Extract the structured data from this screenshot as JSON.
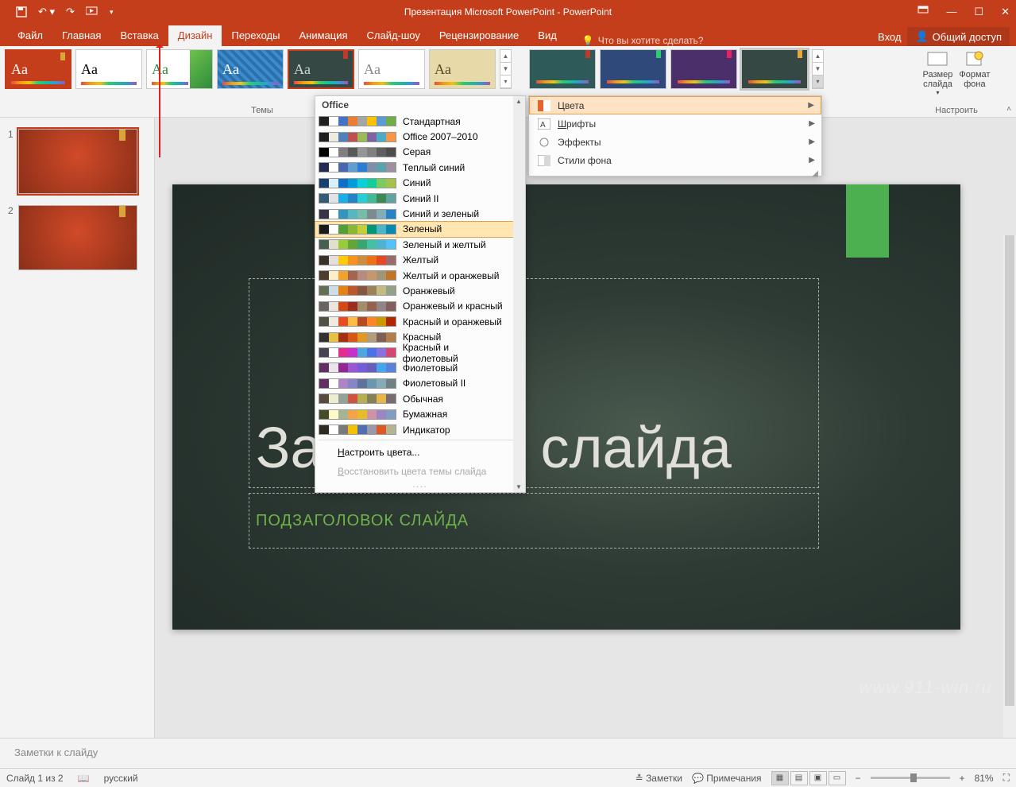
{
  "title": "Презентация Microsoft PowerPoint - PowerPoint",
  "tabs": [
    "Файл",
    "Главная",
    "Вставка",
    "Дизайн",
    "Переходы",
    "Анимация",
    "Слайд-шоу",
    "Рецензирование",
    "Вид"
  ],
  "active_tab": "Дизайн",
  "tell_me": "Что вы хотите сделать?",
  "sign_in": "Вход",
  "share": "Общий доступ",
  "themes_label": "Темы",
  "custom": {
    "size": "Размер\nслайда",
    "format": "Формат\nфона",
    "group": "Настроить"
  },
  "slide_thumbs": [
    {
      "num": "1"
    },
    {
      "num": "2"
    }
  ],
  "slide": {
    "title": "Заголовок слайда",
    "subtitle": "ПОДЗАГОЛОВОК СЛАЙДА"
  },
  "notes_placeholder": "Заметки к слайду",
  "status": {
    "slide": "Слайд 1 из 2",
    "lang": "русский",
    "notes": "Заметки",
    "comments": "Примечания",
    "zoom": "81%"
  },
  "variants_menu": [
    {
      "label": "Цвета",
      "icon": "colors",
      "hover": true
    },
    {
      "label": "Шрифты",
      "icon": "fonts",
      "underline": "Ш"
    },
    {
      "label": "Эффекты",
      "icon": "effects"
    },
    {
      "label": "Стили фона",
      "icon": "bg"
    }
  ],
  "colors_header": "Office",
  "colors_list": [
    {
      "name": "Стандартная",
      "sw": [
        "#1f1f1f",
        "#ffffff",
        "#4472c4",
        "#ed7d31",
        "#a5a5a5",
        "#ffc000",
        "#5b9bd5",
        "#70ad47"
      ]
    },
    {
      "name": "Office 2007–2010",
      "sw": [
        "#1f1f1f",
        "#eeece1",
        "#4f81bd",
        "#c0504d",
        "#9bbb59",
        "#8064a2",
        "#4bacc6",
        "#f79646"
      ]
    },
    {
      "name": "Серая",
      "sw": [
        "#000000",
        "#ffffff",
        "#7f7f7f",
        "#595959",
        "#969696",
        "#808080",
        "#5f5f5f",
        "#4d4d4d"
      ]
    },
    {
      "name": "Теплый синий",
      "sw": [
        "#242852",
        "#ffffff",
        "#4a66ac",
        "#629dd1",
        "#297fd5",
        "#7f8fa9",
        "#5aa2ae",
        "#9d90a0"
      ]
    },
    {
      "name": "Синий",
      "sw": [
        "#17406d",
        "#dbefff",
        "#0f6fc6",
        "#009dd9",
        "#0bd0d9",
        "#10cf9b",
        "#7cca62",
        "#a5c249"
      ]
    },
    {
      "name": "Синий II",
      "sw": [
        "#335b74",
        "#dfe3e5",
        "#1cade4",
        "#2683c6",
        "#27ced7",
        "#42ba97",
        "#3e8853",
        "#62a39f"
      ]
    },
    {
      "name": "Синий и зеленый",
      "sw": [
        "#373545",
        "#ffffff",
        "#3494ba",
        "#58b6c0",
        "#75bda7",
        "#7a8c8e",
        "#84acb6",
        "#2683c6"
      ]
    },
    {
      "name": "Зеленый",
      "sw": [
        "#1a1a1a",
        "#ffffff",
        "#549e39",
        "#8ab833",
        "#c0cf3a",
        "#029676",
        "#4ab5c4",
        "#0989b1"
      ],
      "hover": true
    },
    {
      "name": "Зеленый и желтый",
      "sw": [
        "#455f51",
        "#e2dfcc",
        "#99cb38",
        "#63a537",
        "#37a76f",
        "#44c1a3",
        "#4eb3cf",
        "#51c3f9"
      ]
    },
    {
      "name": "Желтый",
      "sw": [
        "#39302a",
        "#e5dedb",
        "#ffca08",
        "#f8931d",
        "#ce8d3e",
        "#ec7016",
        "#e64823",
        "#9c6a6a"
      ]
    },
    {
      "name": "Желтый и оранжевый",
      "sw": [
        "#4e3b30",
        "#fbeec9",
        "#f0a22e",
        "#a5644e",
        "#b58b80",
        "#c3986d",
        "#a19574",
        "#c17529"
      ]
    },
    {
      "name": "Оранжевый",
      "sw": [
        "#637052",
        "#ccddea",
        "#e48312",
        "#bd582c",
        "#865640",
        "#9b8357",
        "#c2bc80",
        "#94a088"
      ]
    },
    {
      "name": "Оранжевый и красный",
      "sw": [
        "#696464",
        "#e9e5dc",
        "#d34817",
        "#9b2d1f",
        "#a28e6a",
        "#956251",
        "#918485",
        "#855d5d"
      ]
    },
    {
      "name": "Красный и оранжевый",
      "sw": [
        "#505046",
        "#eeece1",
        "#e84c22",
        "#ffbd47",
        "#b64926",
        "#ff8427",
        "#cc9900",
        "#b22600"
      ]
    },
    {
      "name": "Красный",
      "sw": [
        "#323232",
        "#e5c243",
        "#a5300f",
        "#d55816",
        "#e19825",
        "#b19c7d",
        "#7f5f52",
        "#b27d49"
      ]
    },
    {
      "name": "Красный и фиолетовый",
      "sw": [
        "#454551",
        "#ffffff",
        "#e32d91",
        "#c830cc",
        "#4ea6dc",
        "#4775e7",
        "#8971e1",
        "#d54773"
      ]
    },
    {
      "name": "Фиолетовый",
      "sw": [
        "#632e62",
        "#eae5eb",
        "#92278f",
        "#9b57d3",
        "#755dd9",
        "#665eb8",
        "#45a5ed",
        "#5982db"
      ]
    },
    {
      "name": "Фиолетовый II",
      "sw": [
        "#632e62",
        "#ffffff",
        "#ad84c6",
        "#8784c7",
        "#5d739a",
        "#6997af",
        "#84acb6",
        "#6f8183"
      ]
    },
    {
      "name": "Обычная",
      "sw": [
        "#564b3c",
        "#ecedd1",
        "#93a299",
        "#cf543f",
        "#b5ae53",
        "#848058",
        "#e8b54d",
        "#786c71"
      ]
    },
    {
      "name": "Бумажная",
      "sw": [
        "#444d26",
        "#fefac9",
        "#a5b592",
        "#f3a447",
        "#e7bc29",
        "#d092a7",
        "#9c85c0",
        "#809ec2"
      ]
    },
    {
      "name": "Индикатор",
      "sw": [
        "#2f2b20",
        "#ffffff",
        "#7a7a7a",
        "#f5c201",
        "#526db0",
        "#989aac",
        "#dc5924",
        "#b4b392"
      ]
    }
  ],
  "colors_footer": {
    "customize": "Настроить цвета...",
    "reset": "Восстановить цвета темы слайда"
  },
  "watermark": "www.911-win.ru"
}
